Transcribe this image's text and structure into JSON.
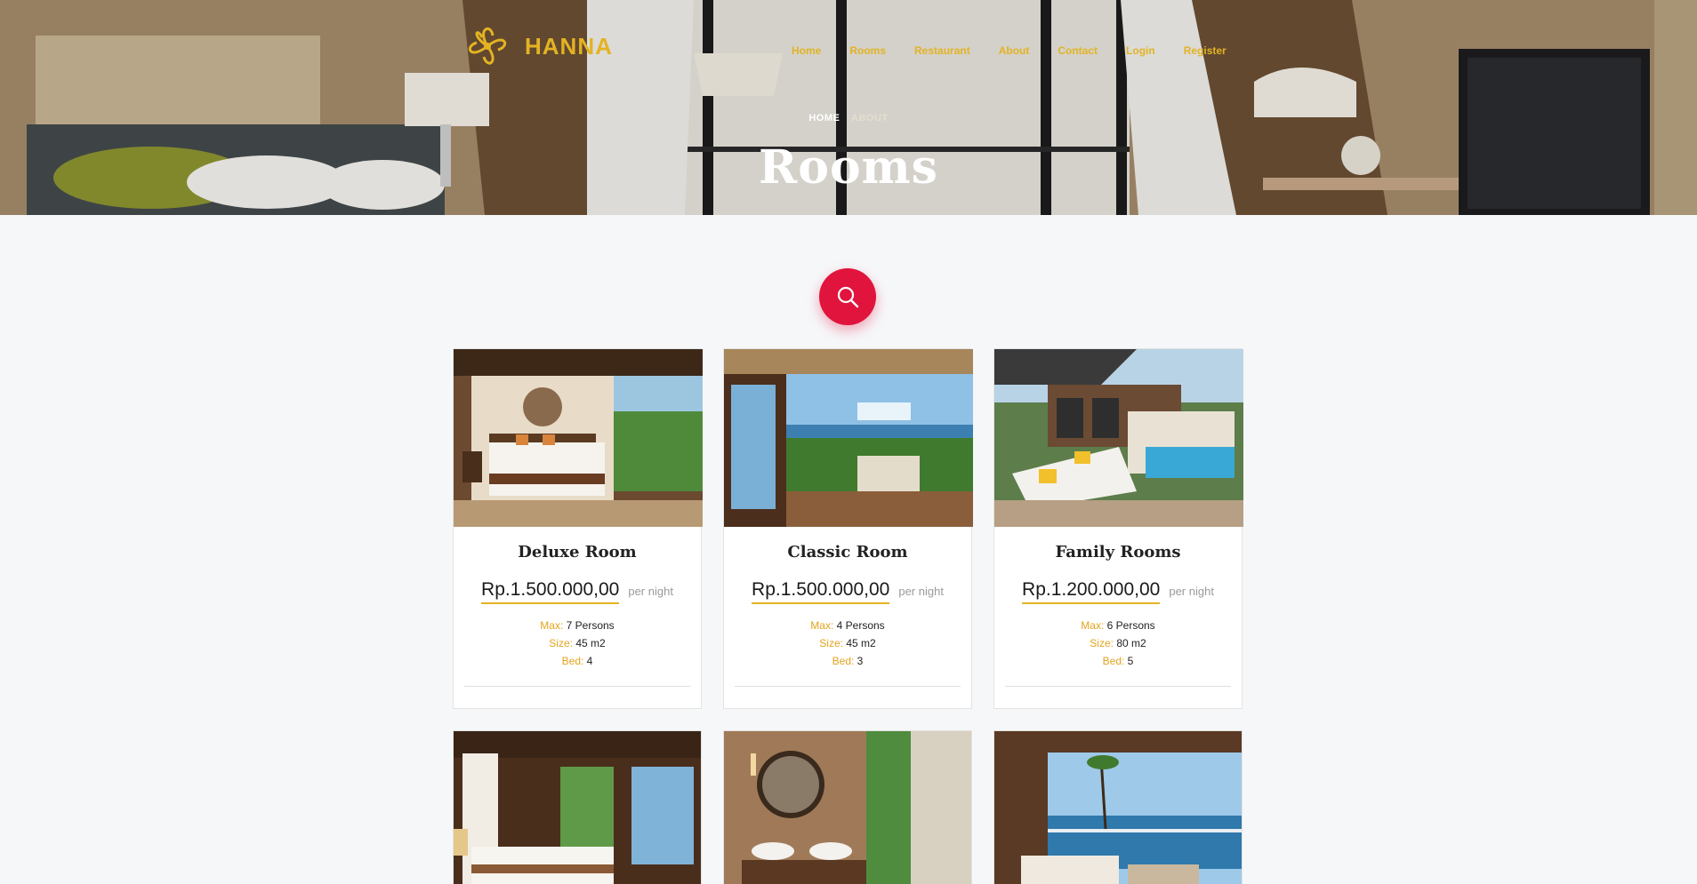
{
  "brand": {
    "name": "HANNA"
  },
  "nav": {
    "items": [
      "Home",
      "Rooms",
      "Restaurant",
      "About",
      "Contact",
      "Login",
      "Register"
    ]
  },
  "breadcrumb": {
    "home": "HOME",
    "current": "ABOUT"
  },
  "hero": {
    "title": "Rooms"
  },
  "colors": {
    "accent_gold": "#e3b323",
    "search_red": "#e0143c",
    "spec_key": "#e3a41e"
  },
  "search": {
    "icon": "search-icon"
  },
  "rooms": [
    {
      "title": "Deluxe Room",
      "price": "Rp.1.500.000,00",
      "per": "per night",
      "max_label": "Max:",
      "max": "7 Persons",
      "size_label": "Size:",
      "size": "45 m2",
      "bed_label": "Bed:",
      "bed": "4"
    },
    {
      "title": "Classic Room",
      "price": "Rp.1.500.000,00",
      "per": "per night",
      "max_label": "Max:",
      "max": "4 Persons",
      "size_label": "Size:",
      "size": "45 m2",
      "bed_label": "Bed:",
      "bed": "3"
    },
    {
      "title": "Family Rooms",
      "price": "Rp.1.200.000,00",
      "per": "per night",
      "max_label": "Max:",
      "max": "6 Persons",
      "size_label": "Size:",
      "size": "80 m2",
      "bed_label": "Bed:",
      "bed": "5"
    }
  ]
}
